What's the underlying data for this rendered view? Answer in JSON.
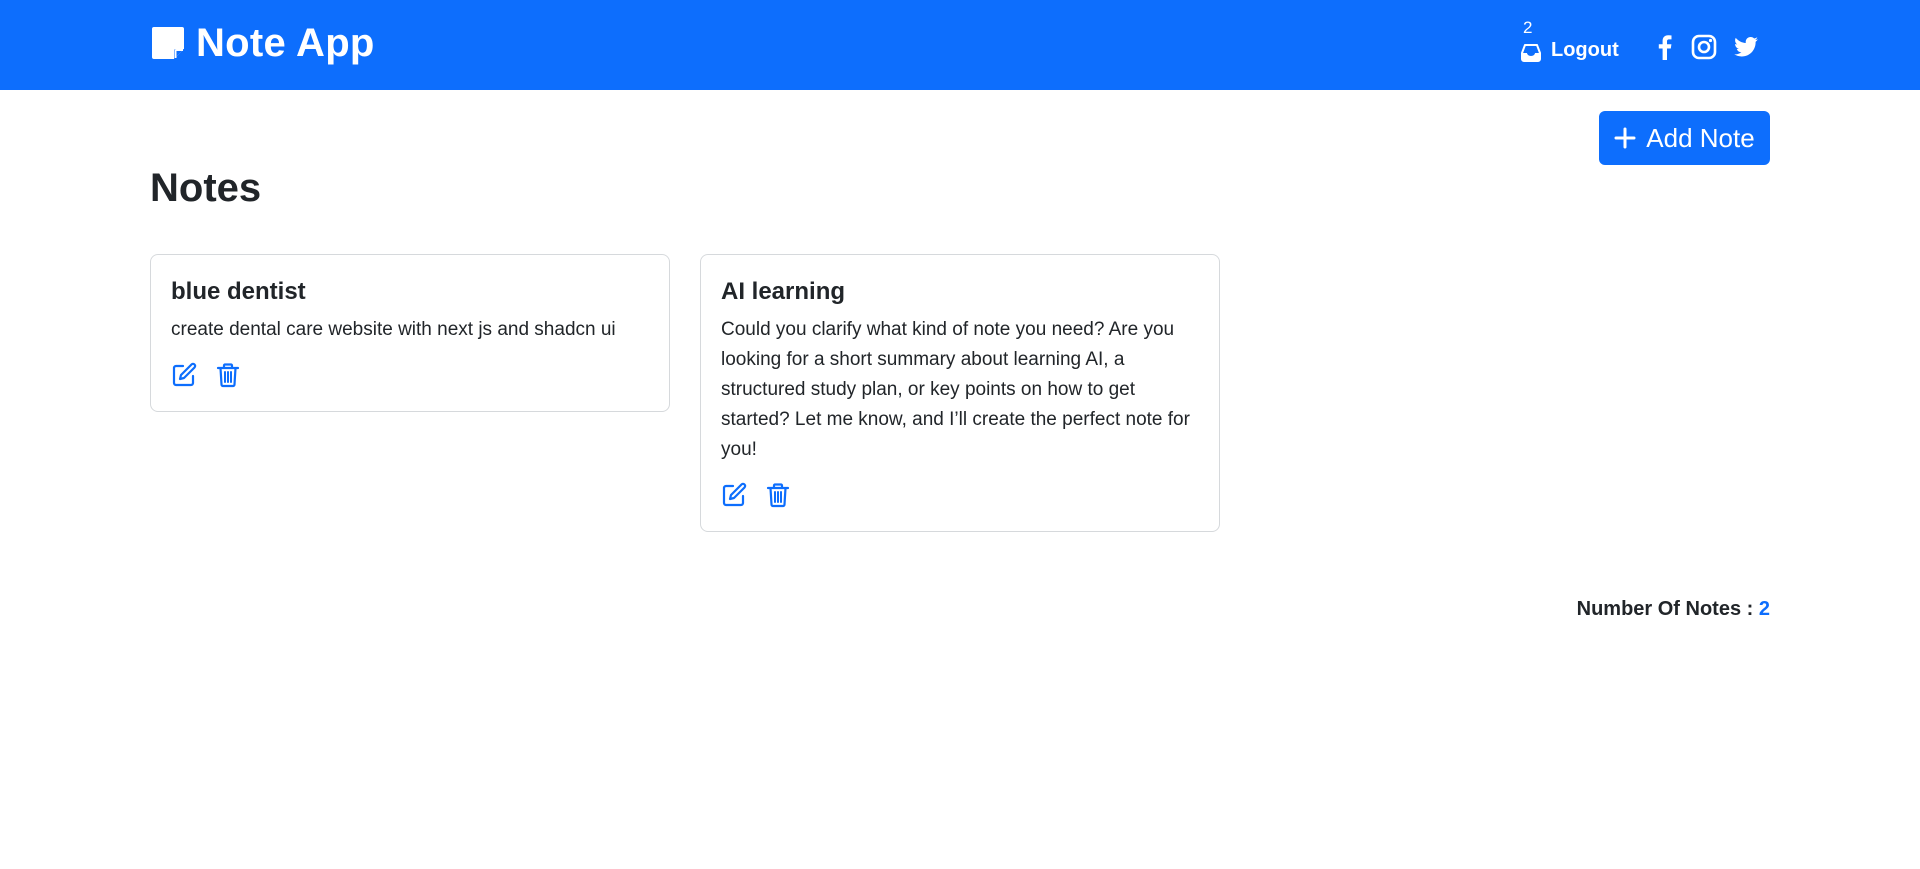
{
  "header": {
    "brand": "Note App",
    "inbox_count": "2",
    "logout_label": "Logout",
    "social": [
      "facebook-icon",
      "instagram-icon",
      "twitter-icon"
    ]
  },
  "toolbar": {
    "add_note_label": "Add Note"
  },
  "page": {
    "title": "Notes"
  },
  "notes": [
    {
      "title": "blue dentist",
      "body": "create dental care website with next js and shadcn ui"
    },
    {
      "title": "AI learning",
      "body": "Could you clarify what kind of note you need? Are you looking for a short summary about learning AI, a structured study plan, or key points on how to get started? Let me know, and I’ll create the perfect note for you!"
    }
  ],
  "footer": {
    "count_label": "Number Of Notes : ",
    "count_value": "2"
  },
  "colors": {
    "primary": "#0d6efd",
    "text": "#212529",
    "card_border": "#d6d9dc"
  }
}
